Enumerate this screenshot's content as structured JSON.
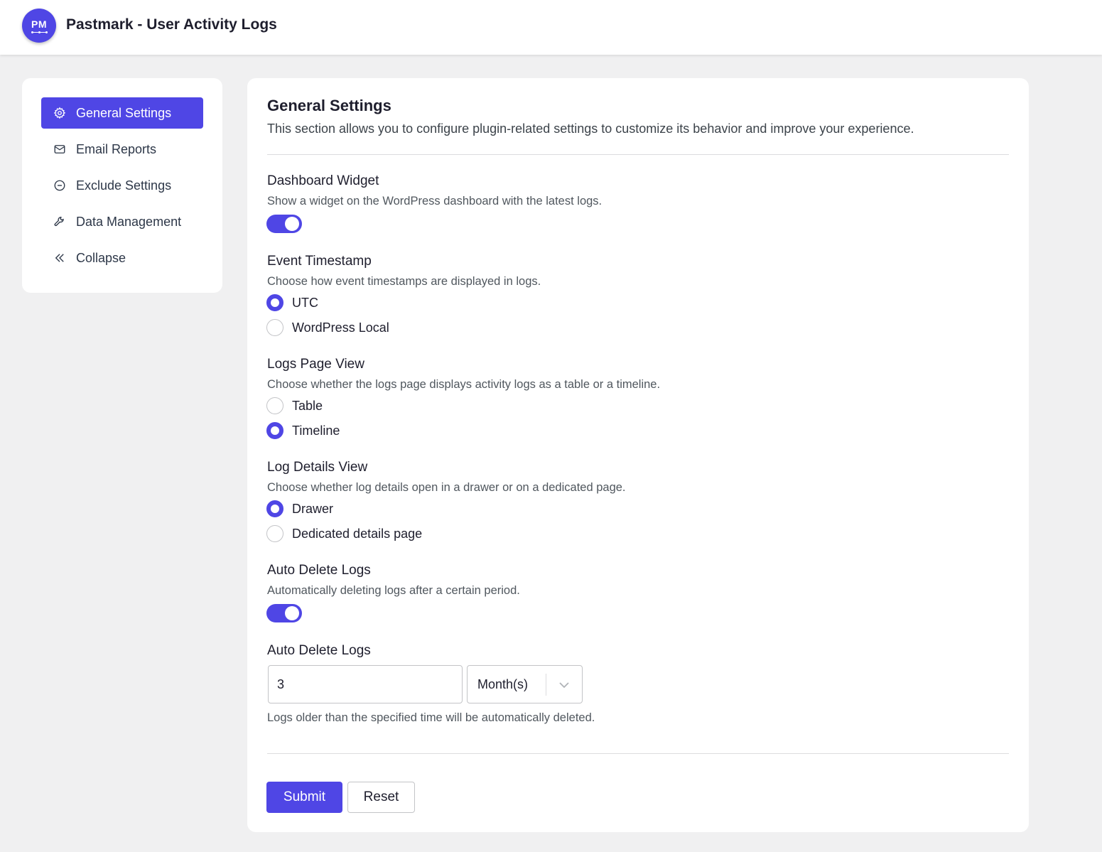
{
  "header": {
    "logo_text": "PM",
    "title": "Pastmark - User Activity Logs"
  },
  "sidebar": {
    "items": [
      {
        "label": "General Settings",
        "icon": "gear-icon",
        "active": true
      },
      {
        "label": "Email Reports",
        "icon": "envelope-icon",
        "active": false
      },
      {
        "label": "Exclude Settings",
        "icon": "minus-circle-icon",
        "active": false
      },
      {
        "label": "Data Management",
        "icon": "wrench-icon",
        "active": false
      },
      {
        "label": "Collapse",
        "icon": "double-chevron-left-icon",
        "active": false
      }
    ]
  },
  "main": {
    "title": "General Settings",
    "description": "This section allows you to configure plugin-related settings to customize its behavior and improve your experience.",
    "dashboard_widget": {
      "label": "Dashboard Widget",
      "help": "Show a widget on the WordPress dashboard with the latest logs.",
      "enabled": true
    },
    "event_timestamp": {
      "label": "Event Timestamp",
      "help": "Choose how event timestamps are displayed in logs.",
      "options": [
        "UTC",
        "WordPress Local"
      ],
      "selected": "UTC"
    },
    "logs_page_view": {
      "label": "Logs Page View",
      "help": "Choose whether the logs page displays activity logs as a table or a timeline.",
      "options": [
        "Table",
        "Timeline"
      ],
      "selected": "Timeline"
    },
    "log_details_view": {
      "label": "Log Details View",
      "help": "Choose whether log details open in a drawer or on a dedicated page.",
      "options": [
        "Drawer",
        "Dedicated details page"
      ],
      "selected": "Drawer"
    },
    "auto_delete_toggle": {
      "label": "Auto Delete Logs",
      "help": "Automatically deleting logs after a certain period.",
      "enabled": true
    },
    "auto_delete_period": {
      "label": "Auto Delete Logs",
      "value": "3",
      "unit": "Month(s)",
      "help": "Logs older than the specified time will be automatically deleted."
    },
    "submit_label": "Submit",
    "reset_label": "Reset"
  },
  "colors": {
    "accent": "#4f46e5",
    "background": "#f0f0f1"
  }
}
